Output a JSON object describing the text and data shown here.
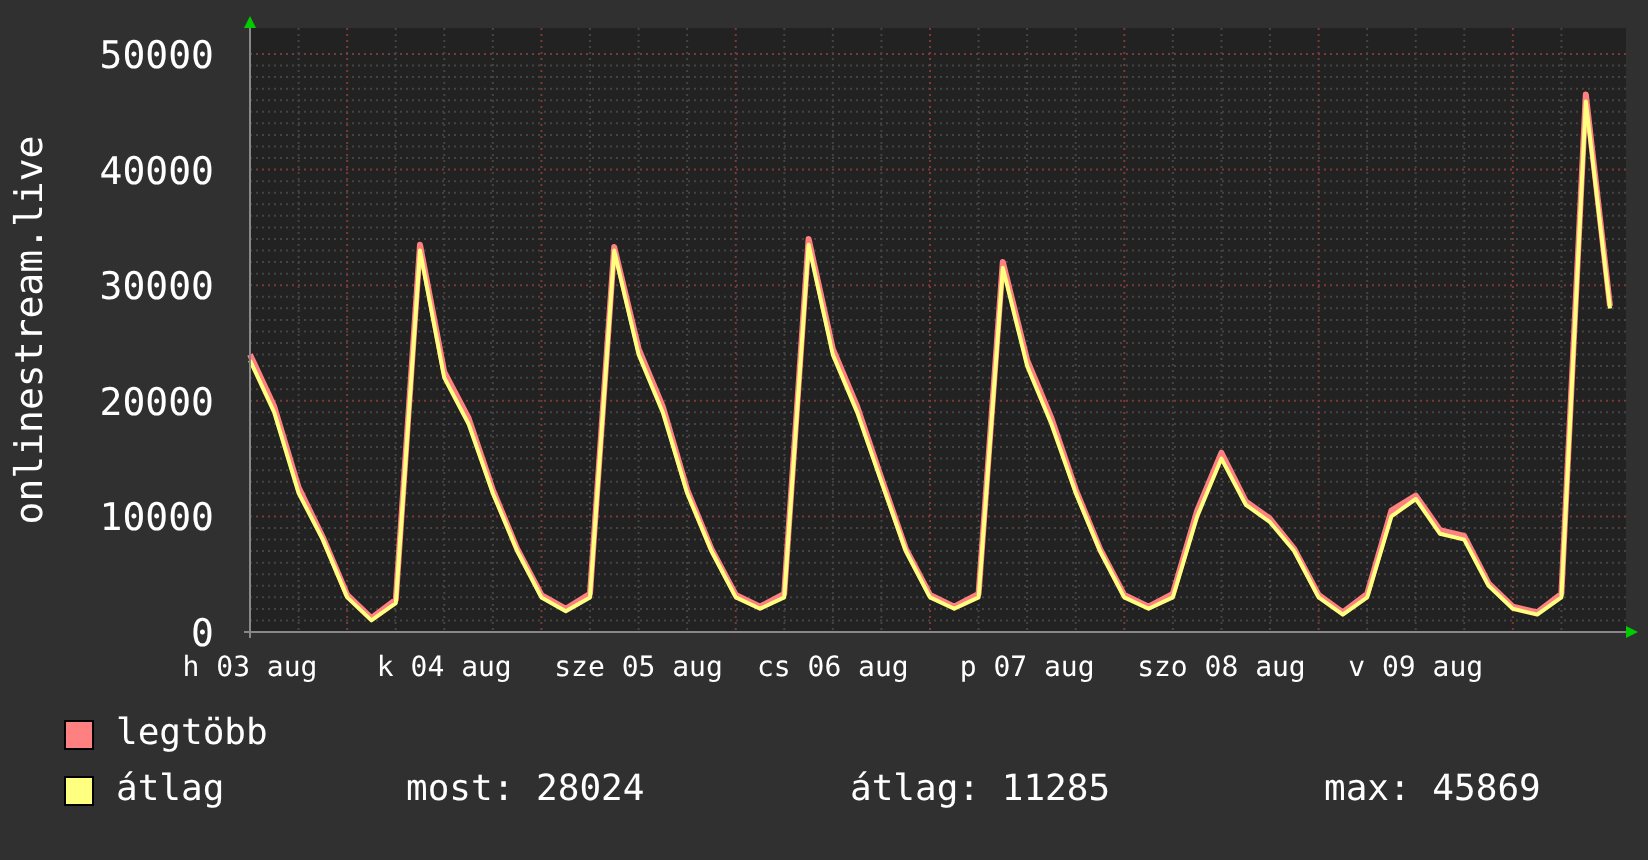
{
  "chart": {
    "chart_data": {
      "type": "line",
      "grid": true,
      "ylabel": "onlinestream.live",
      "categories": [
        "h 03 aug",
        null,
        null,
        null,
        null,
        null,
        null,
        null,
        "k 04 aug",
        null,
        null,
        null,
        null,
        null,
        null,
        null,
        "sze 05 aug",
        null,
        null,
        null,
        null,
        null,
        null,
        null,
        "cs 06 aug",
        null,
        null,
        null,
        null,
        null,
        null,
        null,
        "p 07 aug",
        null,
        null,
        null,
        null,
        null,
        null,
        null,
        "szo 08 aug",
        null,
        null,
        null,
        null,
        null,
        null,
        null,
        "v 09 aug",
        null,
        null,
        null,
        null,
        null,
        null,
        null,
        null
      ],
      "series": [
        {
          "name": "legtöbb",
          "color": "#ff8080",
          "values": [
            24000,
            19500,
            12500,
            8200,
            3200,
            1200,
            2800,
            33500,
            22500,
            18500,
            12300,
            7200,
            3200,
            2000,
            3300,
            33300,
            24500,
            19500,
            12300,
            7200,
            3200,
            2200,
            3300,
            34000,
            24500,
            19500,
            13300,
            7200,
            3200,
            2200,
            3300,
            32000,
            23500,
            18500,
            12300,
            7200,
            3200,
            2200,
            3300,
            10500,
            15500,
            11300,
            9800,
            7200,
            3200,
            1700,
            3300,
            10500,
            11800,
            8800,
            8300,
            4200,
            2200,
            1700,
            3300,
            46500,
            28200
          ]
        },
        {
          "name": "átlag",
          "color": "#ffff80",
          "values": [
            23500,
            19000,
            12000,
            8000,
            3000,
            1000,
            2500,
            33000,
            22000,
            18000,
            12000,
            7000,
            3000,
            1800,
            3000,
            33000,
            24000,
            19000,
            12000,
            7000,
            3000,
            2000,
            3000,
            33500,
            24000,
            19000,
            13000,
            7000,
            3000,
            2000,
            3000,
            31500,
            23000,
            18000,
            12000,
            7000,
            3000,
            2000,
            3000,
            10000,
            15000,
            11000,
            9500,
            7000,
            3000,
            1500,
            3000,
            10000,
            11500,
            8500,
            8000,
            4000,
            2000,
            1500,
            3000,
            45900,
            28000
          ]
        }
      ],
      "ylim": [
        0,
        50000
      ],
      "yticks": [
        0,
        10000,
        20000,
        30000,
        40000,
        50000
      ]
    }
  },
  "stats": [
    "most: 28024",
    "átlag: 11285",
    "max: 45869"
  ]
}
